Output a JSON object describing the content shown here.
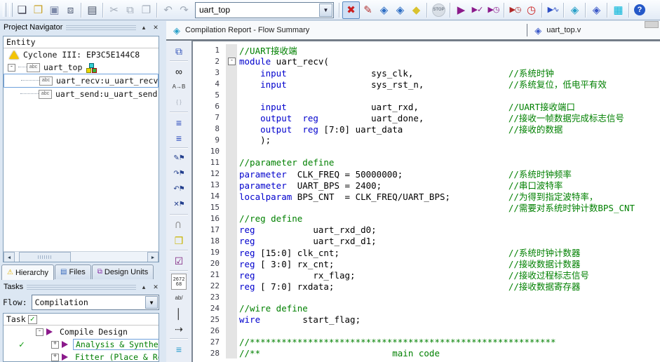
{
  "colors": {
    "keyword": "#0000cd",
    "comment": "#008000",
    "accent_play": "#8b1a8b",
    "task_done": "#007d00",
    "selection_border": "#6ea1dc",
    "warning_yellow": "#f4c400",
    "programmer_cyan": "#00b4d8"
  },
  "toolbar": {
    "entity_combo": "uart_top",
    "left": [
      {
        "name": "new-file-button",
        "glyph": "❏",
        "color": "#333344"
      },
      {
        "name": "open-file-button",
        "glyph": "❒",
        "color": "#c9a227"
      },
      {
        "name": "save-button",
        "glyph": "▣",
        "color": "#7c89a8"
      },
      {
        "name": "save-all-button",
        "glyph": "⧈",
        "color": "#44506a"
      },
      {
        "type": "sep"
      },
      {
        "name": "print-button",
        "glyph": "▤",
        "color": "#4a5568"
      },
      {
        "type": "sep"
      },
      {
        "name": "cut-button",
        "glyph": "✂",
        "color": "#9aa4b2",
        "disabled": true
      },
      {
        "name": "copy-button",
        "glyph": "⧉",
        "color": "#9aa4b2",
        "disabled": true
      },
      {
        "name": "paste-button",
        "glyph": "❐",
        "color": "#9aa4b2",
        "disabled": true
      },
      {
        "type": "sep"
      },
      {
        "name": "undo-button",
        "glyph": "↶",
        "color": "#9aa4b2",
        "disabled": true
      },
      {
        "name": "redo-button",
        "glyph": "↷",
        "color": "#9aa4b2",
        "disabled": true
      }
    ],
    "right": [
      {
        "name": "pin-planner-button",
        "glyph": "✖",
        "color": "#cc2020",
        "pressed": true
      },
      {
        "name": "assignment-editor-button",
        "glyph": "✎",
        "color": "#b23535"
      },
      {
        "name": "settings-button",
        "glyph": "◈",
        "color": "#2b6cc4"
      },
      {
        "name": "analysis-settings-button",
        "glyph": "◈",
        "color": "#2b6cc4"
      },
      {
        "name": "device-button",
        "glyph": "◆",
        "color": "#d9c22e"
      },
      {
        "type": "sep"
      },
      {
        "name": "stop-processing-button",
        "glyph": "STOP",
        "color": "#6b7684",
        "disabled": true,
        "tiny": true
      },
      {
        "type": "sep"
      },
      {
        "name": "start-compilation-button",
        "glyph": "▶",
        "color": "#8b1a8b"
      },
      {
        "name": "start-analysis-synthesis-button",
        "glyph": "▶✓",
        "color": "#8b1a8b",
        "small": true
      },
      {
        "name": "start-timing-analysis-button",
        "glyph": "▶◷",
        "color": "#8b1a8b",
        "small": true
      },
      {
        "type": "sep"
      },
      {
        "name": "start-timequest-button",
        "glyph": "▶◷",
        "color": "#b02828",
        "small": true
      },
      {
        "name": "classic-timing-analyzer-button",
        "glyph": "◷",
        "color": "#cc2222"
      },
      {
        "type": "sep"
      },
      {
        "name": "simulator-button",
        "glyph": "▶∿",
        "color": "#2b4cc4",
        "small": true
      },
      {
        "type": "sep"
      },
      {
        "name": "compilation-report-button",
        "glyph": "◈",
        "color": "#28a0c8"
      },
      {
        "type": "sep"
      },
      {
        "name": "rtl-viewer-button",
        "glyph": "◈",
        "color": "#3a58c8"
      },
      {
        "type": "sep"
      },
      {
        "name": "programmer-button",
        "glyph": "▦",
        "color": "#00b4d8"
      },
      {
        "type": "sep"
      },
      {
        "name": "help-button",
        "glyph": "?",
        "color": "#ffffff",
        "round": true
      }
    ]
  },
  "project_navigator": {
    "title": "Project Navigator",
    "column_header": "Entity",
    "tree": [
      {
        "type": "device",
        "label": "Cyclone III: EP3C5E144C8"
      },
      {
        "type": "top",
        "label": "uart_top"
      },
      {
        "type": "child",
        "label": "uart_recv:u_uart_recv",
        "selected": true
      },
      {
        "type": "child",
        "label": "uart_send:u_uart_send"
      }
    ],
    "tabs": [
      {
        "name": "tab-hierarchy",
        "label": "Hierarchy",
        "icon": "⚠",
        "icon_color": "#e0b000",
        "active": true
      },
      {
        "name": "tab-files",
        "label": "Files",
        "icon": "▤",
        "icon_color": "#3366bb",
        "active": false
      },
      {
        "name": "tab-design-units",
        "label": "Design Units",
        "icon": "⧉",
        "icon_color": "#8833aa",
        "active": false
      }
    ]
  },
  "tasks": {
    "title": "Tasks",
    "flow_label": "Flow:",
    "flow_value": "Compilation",
    "column_header": "Task",
    "rows": [
      {
        "label": "Compile Design",
        "expander": "-",
        "check": false,
        "done": false,
        "selected": false,
        "indent": 0
      },
      {
        "label": "Analysis & Synthesis",
        "expander": "+",
        "check": true,
        "done": true,
        "selected": true,
        "indent": 1
      },
      {
        "label": "Fitter (Place & Route)",
        "expander": "+",
        "check": false,
        "done": true,
        "selected": false,
        "indent": 1
      }
    ]
  },
  "editor": {
    "tabs": [
      {
        "label": "Compilation Report - Flow Summary",
        "icon": "report-diamond-icon",
        "glyph": "◈",
        "color": "#28a0c8"
      },
      {
        "label": "uart_top.v",
        "icon": "verilog-file-icon",
        "glyph": "◈",
        "color": "#3a58c8"
      }
    ],
    "side_toolbar": [
      {
        "name": "new-window-button",
        "glyph": "⧉",
        "color": "#3355bb"
      },
      {
        "type": "sep"
      },
      {
        "name": "find-button",
        "glyph": "∞",
        "color": "#111111"
      },
      {
        "name": "replace-button",
        "glyph": "A→B",
        "color": "#333333",
        "tiny": true
      },
      {
        "name": "match-brace-button",
        "glyph": "{ }",
        "color": "#a8b0bc",
        "tiny": true,
        "disabled": true
      },
      {
        "type": "sep"
      },
      {
        "name": "increase-indent-button",
        "glyph": "≡",
        "color": "#2244bb"
      },
      {
        "name": "decrease-indent-button",
        "glyph": "≡",
        "color": "#2244bb"
      },
      {
        "type": "sep"
      },
      {
        "name": "toggle-bookmark-button",
        "glyph": "✎⚑",
        "color": "#24408e",
        "small": true
      },
      {
        "name": "next-bookmark-button",
        "glyph": "↷⚑",
        "color": "#24408e",
        "small": true
      },
      {
        "name": "prev-bookmark-button",
        "glyph": "↶⚑",
        "color": "#24408e",
        "small": true
      },
      {
        "name": "clear-bookmarks-button",
        "glyph": "✕⚑",
        "color": "#24408e",
        "small": true
      },
      {
        "type": "sep"
      },
      {
        "name": "attach-button",
        "glyph": "⊂",
        "color": "#888888",
        "rot": true
      },
      {
        "name": "insert-template-button",
        "glyph": "❒",
        "color": "#c8b400"
      },
      {
        "type": "sep"
      },
      {
        "name": "analyze-current-file-button",
        "glyph": "☑",
        "color": "#7d1f7d"
      },
      {
        "type": "sep"
      },
      {
        "name": "line-numbers-button",
        "glyph": "267268",
        "two": true,
        "color": "#333333"
      },
      {
        "name": "special-chars-button",
        "glyph": "ab/",
        "color": "#333333",
        "tiny": true
      },
      {
        "name": "column-select-button",
        "glyph": "│",
        "color": "#111111"
      },
      {
        "name": "whitespace-arrow-button",
        "glyph": "⇢",
        "color": "#333333"
      },
      {
        "type": "sep"
      },
      {
        "name": "align-button",
        "glyph": "≡",
        "color": "#2299cc"
      }
    ],
    "code": {
      "language": "verilog",
      "lines": [
        {
          "n": 1,
          "seg": [
            [
              "cm",
              "//UART接收端"
            ]
          ]
        },
        {
          "n": 2,
          "fold": true,
          "seg": [
            [
              "kw",
              "module"
            ],
            [
              "pl",
              " uart_recv("
            ]
          ]
        },
        {
          "n": 3,
          "seg": [
            [
              "pl",
              "    "
            ],
            [
              "kw",
              "input"
            ],
            [
              "pl",
              "                sys_clk,                  "
            ],
            [
              "cm",
              "//系统时钟"
            ]
          ]
        },
        {
          "n": 4,
          "seg": [
            [
              "pl",
              "    "
            ],
            [
              "kw",
              "input"
            ],
            [
              "pl",
              "                sys_rst_n,                "
            ],
            [
              "cm",
              "//系统复位，低电平有效"
            ]
          ]
        },
        {
          "n": 5,
          "seg": []
        },
        {
          "n": 6,
          "seg": [
            [
              "pl",
              "    "
            ],
            [
              "kw",
              "input"
            ],
            [
              "pl",
              "                uart_rxd,                 "
            ],
            [
              "cm",
              "//UART接收端口"
            ]
          ]
        },
        {
          "n": 7,
          "seg": [
            [
              "pl",
              "    "
            ],
            [
              "kw",
              "output"
            ],
            [
              "pl",
              "  "
            ],
            [
              "kw",
              "reg"
            ],
            [
              "pl",
              "          uart_done,                "
            ],
            [
              "cm",
              "//接收一帧数据完成标志信号"
            ]
          ]
        },
        {
          "n": 8,
          "seg": [
            [
              "pl",
              "    "
            ],
            [
              "kw",
              "output"
            ],
            [
              "pl",
              "  "
            ],
            [
              "kw",
              "reg"
            ],
            [
              "pl",
              " [7:0] uart_data                    "
            ],
            [
              "cm",
              "//接收的数据"
            ]
          ]
        },
        {
          "n": 9,
          "seg": [
            [
              "pl",
              "    );"
            ]
          ]
        },
        {
          "n": 10,
          "seg": []
        },
        {
          "n": 11,
          "seg": [
            [
              "cm",
              "//parameter define"
            ]
          ]
        },
        {
          "n": 12,
          "seg": [
            [
              "kw",
              "parameter"
            ],
            [
              "pl",
              "  CLK_FREQ = 50000000;                    "
            ],
            [
              "cm",
              "//系统时钟频率"
            ]
          ]
        },
        {
          "n": 13,
          "seg": [
            [
              "kw",
              "parameter"
            ],
            [
              "pl",
              "  UART_BPS = 2400;                        "
            ],
            [
              "cm",
              "//串口波特率"
            ]
          ]
        },
        {
          "n": 14,
          "seg": [
            [
              "kw",
              "localparam"
            ],
            [
              "pl",
              " BPS_CNT  = CLK_FREQ/UART_BPS;           "
            ],
            [
              "cm",
              "//为得到指定波特率，"
            ]
          ]
        },
        {
          "n": 15,
          "seg": [
            [
              "pl",
              "                                                   "
            ],
            [
              "cm",
              "//需要对系统时钟计数BPS_CNT"
            ]
          ]
        },
        {
          "n": 16,
          "seg": [
            [
              "cm",
              "//reg define"
            ]
          ]
        },
        {
          "n": 17,
          "seg": [
            [
              "kw",
              "reg"
            ],
            [
              "pl",
              "           uart_rxd_d0;"
            ]
          ]
        },
        {
          "n": 18,
          "seg": [
            [
              "kw",
              "reg"
            ],
            [
              "pl",
              "           uart_rxd_d1;"
            ]
          ]
        },
        {
          "n": 19,
          "seg": [
            [
              "kw",
              "reg"
            ],
            [
              "pl",
              " [15:0] clk_cnt;                                "
            ],
            [
              "cm",
              "//系统时钟计数器"
            ]
          ]
        },
        {
          "n": 20,
          "seg": [
            [
              "kw",
              "reg"
            ],
            [
              "pl",
              " [ 3:0] rx_cnt;                                 "
            ],
            [
              "cm",
              "//接收数据计数器"
            ]
          ]
        },
        {
          "n": 21,
          "seg": [
            [
              "kw",
              "reg"
            ],
            [
              "pl",
              "           rx_flag;                             "
            ],
            [
              "cm",
              "//接收过程标志信号"
            ]
          ]
        },
        {
          "n": 22,
          "seg": [
            [
              "kw",
              "reg"
            ],
            [
              "pl",
              " [ 7:0] rxdata;                                 "
            ],
            [
              "cm",
              "//接收数据寄存器"
            ]
          ]
        },
        {
          "n": 23,
          "seg": []
        },
        {
          "n": 24,
          "seg": [
            [
              "cm",
              "//wire define"
            ]
          ]
        },
        {
          "n": 25,
          "seg": [
            [
              "kw",
              "wire"
            ],
            [
              "pl",
              "        start_flag;"
            ]
          ]
        },
        {
          "n": 26,
          "seg": []
        },
        {
          "n": 27,
          "seg": [
            [
              "cm",
              "//**********************************************************"
            ]
          ]
        },
        {
          "n": 28,
          "seg": [
            [
              "cm",
              "//**                         main code"
            ]
          ]
        }
      ]
    }
  }
}
